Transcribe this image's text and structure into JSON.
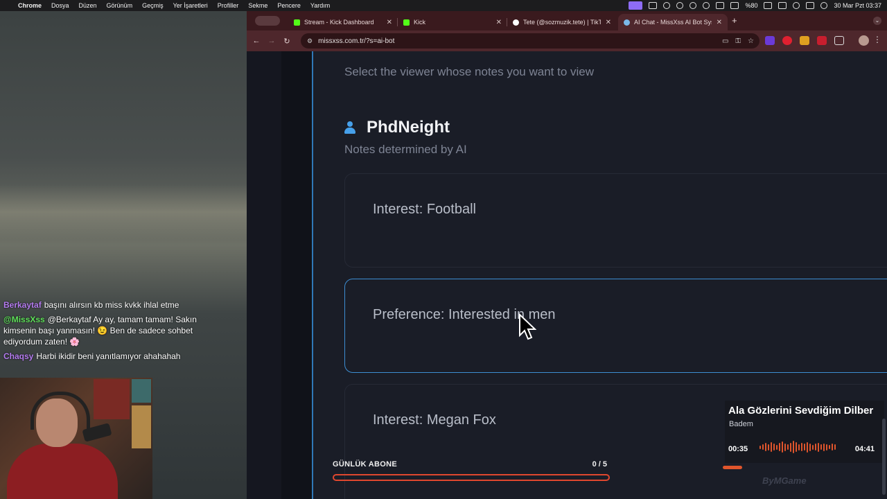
{
  "menubar": {
    "app": "Chrome",
    "items": [
      "Dosya",
      "Düzen",
      "Görünüm",
      "Geçmiş",
      "Yer İşaretleri",
      "Profiller",
      "Sekme",
      "Pencere",
      "Yardım"
    ],
    "battery": "%80",
    "datetime": "30 Mar Pzt  03:37"
  },
  "chat": {
    "messages": [
      {
        "user": "Berkaytaf",
        "user_color": "#b57cf0",
        "text": "başını alırsın kb miss kvkk ihlal etme"
      },
      {
        "user": "@MissXss",
        "user_color": "#5fe05a",
        "text": "@Berkaytaf Ay ay, tamam tamam! Sakın kimsenin başı yanmasın! 😉 Ben de sadece sohbet ediyordum zaten! 🌸"
      },
      {
        "user": "Chaqsy",
        "user_color": "#b57cf0",
        "text": "Harbi ikidir beni yanıtlamıyor ahahahah"
      }
    ]
  },
  "browser": {
    "tabs": [
      {
        "label": "Stream - Kick Dashboard",
        "favicon_color": "#53fc18",
        "active": false
      },
      {
        "label": "Kick",
        "favicon_color": "#53fc18",
        "active": false
      },
      {
        "label": "Tete (@sozmuzik.tete) | TikTo",
        "favicon_color": "#ffffff",
        "active": false
      },
      {
        "label": "AI Chat - MissXss AI Bot Syst",
        "favicon_color": "#7ab8e8",
        "active": true
      }
    ],
    "url": "missxss.com.tr/?s=ai-bot"
  },
  "page": {
    "hint": "Select the viewer whose notes you want to view",
    "viewer_name": "PhdNeight",
    "notes_subtitle": "Notes determined by AI",
    "notes": [
      {
        "text": "Interest: Football",
        "selected": false
      },
      {
        "text": "Preference: Interested in men",
        "selected": true
      },
      {
        "text": "Interest: Megan Fox",
        "selected": false
      }
    ]
  },
  "overlay": {
    "sub_goal_label": "GÜNLÜK ABONE",
    "sub_goal_count": "0 / 5",
    "sub_goal_progress": 0,
    "song_title": "Ala Gözlerini Sevdiğim Dilber",
    "song_artist": "Badem",
    "elapsed": "00:35",
    "duration": "04:41",
    "watermark": "ByMGame"
  },
  "colors": {
    "accent": "#3d8ed3",
    "tabbar": "#3a1a1e",
    "toolbar": "#4e272c",
    "overlay_accent": "#e0552c"
  }
}
